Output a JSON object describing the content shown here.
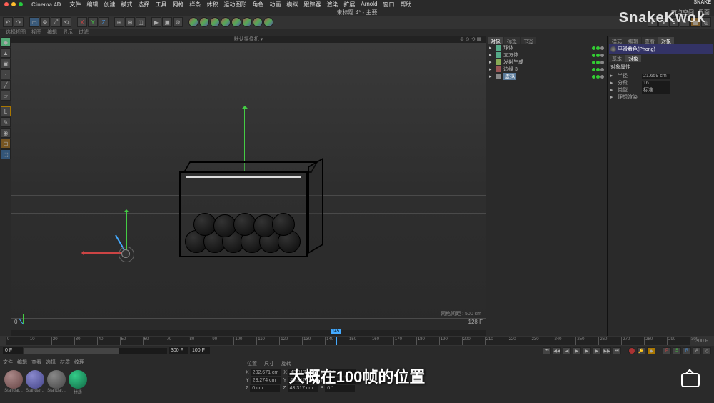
{
  "mac": {
    "app": "Cinema 4D",
    "items": [
      "文件",
      "编辑",
      "创建",
      "模式",
      "选择",
      "工具",
      "网格",
      "样条",
      "体积",
      "运动图形",
      "角色",
      "动画",
      "模拟",
      "跟踪器",
      "渲染",
      "扩展",
      "Arnold",
      "窗口",
      "帮助"
    ]
  },
  "title": {
    "doc": "未标题 4* - 主要",
    "right1": "节点空间",
    "right2": "界面"
  },
  "topright_brand": "SNAKE",
  "subbar": [
    "选择视图",
    "视图",
    "编辑",
    "显示",
    "过滤"
  ],
  "vp_header": "默认摄像机  ▾",
  "vp_info": "网格间距 : 500 cm",
  "ruler": {
    "start": 0,
    "end_label": "128 F"
  },
  "timeline": {
    "start": "0 F",
    "end": "300 F",
    "cur": "100 F",
    "total": "300 F",
    "ticks": [
      0,
      10,
      20,
      30,
      40,
      50,
      60,
      70,
      80,
      90,
      100,
      110,
      120,
      130,
      140,
      150,
      160,
      170,
      180,
      190,
      200,
      210,
      220,
      230,
      240,
      250,
      260,
      270,
      280,
      290,
      300
    ],
    "cursor_frame": 145
  },
  "objects": [
    {
      "name": "球体",
      "sel": false,
      "color": "#5a8"
    },
    {
      "name": "立方体",
      "sel": false,
      "color": "#5a8"
    },
    {
      "name": "发射生成",
      "sel": false,
      "color": "#8a5"
    },
    {
      "name": "边缘 3",
      "sel": false,
      "color": "#955"
    },
    {
      "name": "虚拟",
      "sel": true,
      "color": "#888"
    }
  ],
  "attr": {
    "tabs": [
      "模式",
      "编辑",
      "查看",
      "对象"
    ],
    "panel_label": "对象",
    "section": "对象属性",
    "mat_label": "平滑着色(Phong)",
    "rows": [
      {
        "k": "半径",
        "v": "21.659 cm"
      },
      {
        "k": "分段",
        "v": "16"
      },
      {
        "k": "类型",
        "v": "标准"
      },
      {
        "k": "理想渲染",
        "v": ""
      }
    ]
  },
  "coords": {
    "tabs": [
      "位置",
      "尺寸",
      "旋转"
    ],
    "X": {
      "p": "202.671 cm",
      "s": "43.317 cm",
      "r": "0 °"
    },
    "Y": {
      "p": "23.274 cm",
      "s": "43.317 cm",
      "r": "0 °"
    },
    "Z": {
      "p": "0 cm",
      "s": "43.317 cm",
      "r": "0 °"
    }
  },
  "materials": {
    "tabs": [
      "文件",
      "编辑",
      "查看",
      "选择",
      "材质",
      "纹理"
    ],
    "items": [
      {
        "name": "Standar...",
        "c1": "#a88",
        "c2": "#644"
      },
      {
        "name": "Standar...",
        "c1": "#88c",
        "c2": "#448"
      },
      {
        "name": "Standar...",
        "c1": "#888",
        "c2": "#444"
      },
      {
        "name": "材质",
        "c1": "#3c8",
        "c2": "#164"
      }
    ]
  },
  "watermark": "SnakeKwok",
  "bili": "bilibili",
  "subtitle": "大概在100帧的位置"
}
